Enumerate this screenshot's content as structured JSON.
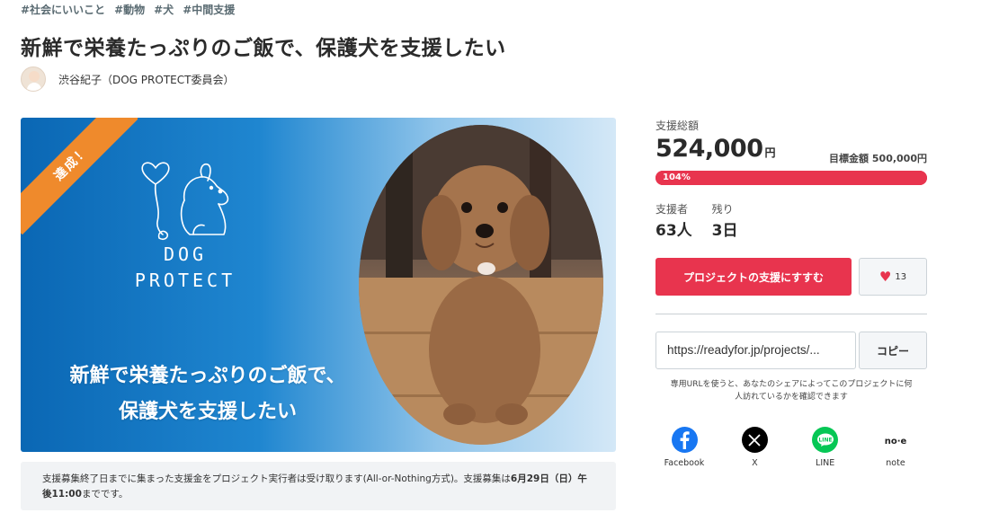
{
  "tags": [
    "#社会にいいこと",
    "#動物",
    "#犬",
    "#中間支援"
  ],
  "title": "新鮮で栄養たっぷりのご飯で、保護犬を支援したい",
  "owner": {
    "name": "渋谷紀子（DOG PROTECT委員会）"
  },
  "hero": {
    "badge": "達成！",
    "logo_line1": "DOG",
    "logo_line2": "PROTECT",
    "caption_line1": "新鮮で栄養たっぷりのご飯で、",
    "caption_line2": "保護犬を支援したい"
  },
  "notice": {
    "text_before": "支援募集終了日までに集まった支援金をプロジェクト実行者は受け取ります(All-or-Nothing方式)。支援募集は",
    "deadline": "6月29日（日）午後11:00",
    "text_after": "までです。"
  },
  "funding": {
    "total_label": "支援総額",
    "amount": "524,000",
    "currency": "円",
    "target_label": "目標金額",
    "target_value": "500,000円",
    "progress_percent": 104,
    "progress_text": "104%",
    "backers_label": "支援者",
    "backers_value": "63人",
    "remaining_label": "残り",
    "remaining_value": "3日"
  },
  "actions": {
    "support_label": "プロジェクトの支援にすすむ",
    "favorite_count": "13"
  },
  "share": {
    "url": "https://readyfor.jp/projects/...",
    "copy_label": "コピー",
    "note": "専用URLを使うと、あなたのシェアによってこのプロジェクトに何人訪れているかを確認できます",
    "items": [
      {
        "label": "Facebook",
        "icon": "facebook-icon",
        "color": "#1877f2"
      },
      {
        "label": "X",
        "icon": "x-icon",
        "color": "#000000"
      },
      {
        "label": "LINE",
        "icon": "line-icon",
        "color": "#06c755"
      },
      {
        "label": "note",
        "icon": "note-icon",
        "color": "#ffffff"
      }
    ]
  },
  "colors": {
    "accent": "#e8344e",
    "ribbon": "#ef8a2c",
    "hero_blue": "#0a67b4"
  }
}
